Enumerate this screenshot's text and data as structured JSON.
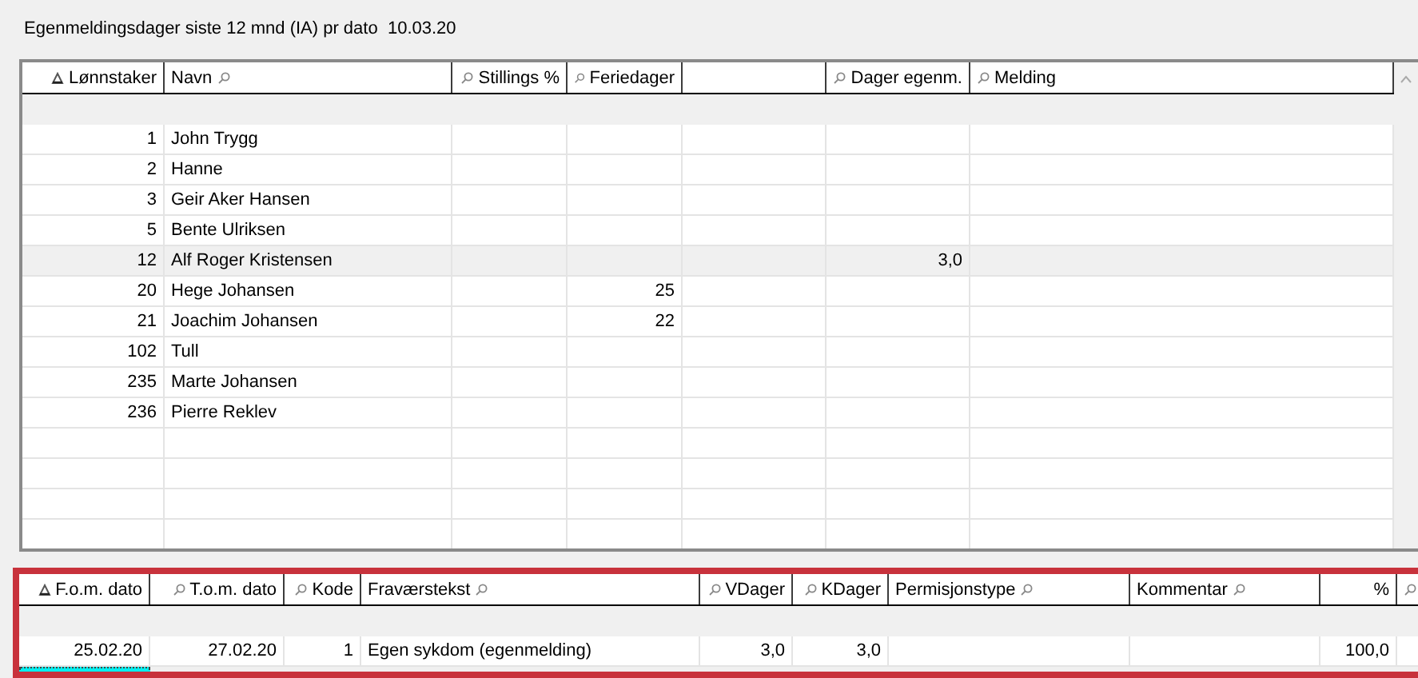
{
  "title": "Egenmeldingsdager siste 12 mnd (IA) pr dato  10.03.20",
  "employees": {
    "columns": [
      {
        "label": "Lønnstaker",
        "kind": "sorted"
      },
      {
        "label": "Navn",
        "kind": "search-after"
      },
      {
        "label": "Stillings %",
        "kind": "search-before"
      },
      {
        "label": "Feriedager",
        "kind": "search-before"
      },
      {
        "kind": "plain"
      },
      {
        "label": "Dager egenm.",
        "kind": "search-before"
      },
      {
        "label": "Melding",
        "kind": "search-before"
      }
    ],
    "rows": [
      {
        "number": "1",
        "name": "John Trygg",
        "selected": false
      },
      {
        "number": "2",
        "name": "Hanne",
        "selected": false
      },
      {
        "number": "3",
        "name": "Geir Aker Hansen",
        "selected": false
      },
      {
        "number": "5",
        "name": "Bente Ulriksen",
        "selected": false
      },
      {
        "number": "12",
        "name": "Alf Roger Kristensen",
        "self_days": "3,0",
        "selected": true
      },
      {
        "number": "20",
        "name": "Hege Johansen",
        "vacation": "25",
        "selected": false
      },
      {
        "number": "21",
        "name": "Joachim Johansen",
        "vacation": "22",
        "selected": false
      },
      {
        "number": "102",
        "name": "Tull",
        "selected": false
      },
      {
        "number": "235",
        "name": "Marte Johansen",
        "selected": false
      },
      {
        "number": "236",
        "name": "Pierre Reklev",
        "selected": false
      }
    ]
  },
  "absences": {
    "highlighted": true,
    "new_row_focused": true,
    "columns": [
      {
        "label": "F.o.m. dato",
        "kind": "sorted"
      },
      {
        "label": "T.o.m. dato",
        "kind": "search-before"
      },
      {
        "label": "Kode",
        "kind": "search-before"
      },
      {
        "label": "Fraværstekst",
        "kind": "search-after"
      },
      {
        "label": "VDager",
        "kind": "search-before"
      },
      {
        "label": "KDager",
        "kind": "search-before"
      },
      {
        "label": "Permisjonstype",
        "kind": "search-after"
      },
      {
        "label": "Kommentar",
        "kind": "search-after"
      },
      {
        "label": "%",
        "kind": "plain"
      },
      {
        "kind": "search-before"
      }
    ],
    "rows": [
      {
        "from": "25.02.20",
        "to": "27.02.20",
        "code": "1",
        "text": "Egen sykdom (egenmelding)",
        "vdays": "3,0",
        "kdays": "3,0",
        "pct": "100,0",
        "selected": false
      }
    ]
  }
}
